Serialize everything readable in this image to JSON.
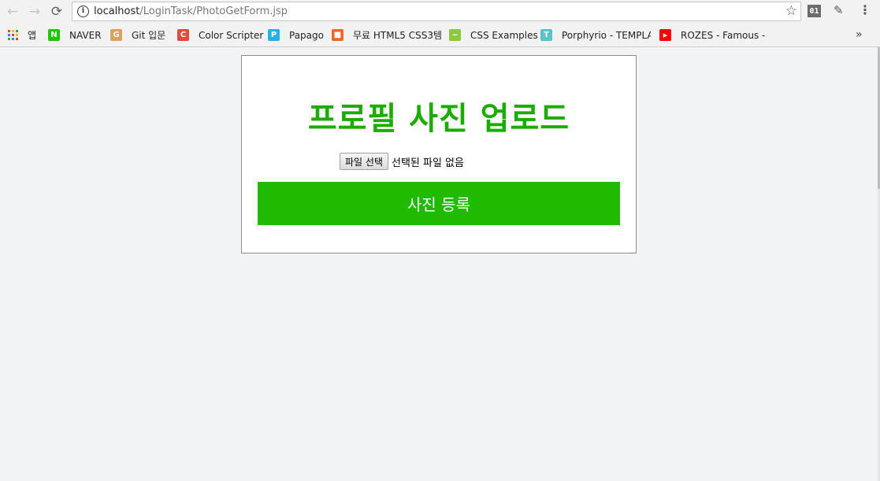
{
  "browser": {
    "url_host": "localhost",
    "url_path": "/LoginTask/PhotoGetForm.jsp",
    "extension_badge": "01"
  },
  "bookmarks": [
    {
      "label": "앱",
      "icon": "apps-grid-icon"
    },
    {
      "label": "NAVER",
      "icon": "naver-icon",
      "color": "#1ec800",
      "glyph": "N"
    },
    {
      "label": "Git 입문",
      "icon": "git-icon",
      "color": "#d9a25f",
      "glyph": "G"
    },
    {
      "label": "Color Scripter",
      "icon": "color-scripter-icon",
      "color": "#e8473d",
      "glyph": "C"
    },
    {
      "label": "Papago",
      "icon": "papago-icon",
      "color": "#21b2e6",
      "glyph": "P"
    },
    {
      "label": "무료 HTML5 CSS3템",
      "icon": "template-icon",
      "color": "#f26522",
      "glyph": "■"
    },
    {
      "label": "CSS Examples",
      "icon": "css-examples-icon",
      "color": "#8dc63f",
      "glyph": "~"
    },
    {
      "label": "Porphyrio - TEMPLA",
      "icon": "porphyrio-icon",
      "color": "#5bc0c8",
      "glyph": "T"
    },
    {
      "label": "ROZES - Famous - Y",
      "icon": "youtube-icon",
      "color": "#ff0000",
      "glyph": "▶"
    }
  ],
  "form": {
    "title": "프로필 사진 업로드",
    "file_button_label": "파일 선택",
    "file_status": "선택된 파일 없음",
    "submit_label": "사진 등록"
  },
  "colors": {
    "title": "#1cac00",
    "submit_bg": "#20bb00",
    "page_bg": "#f2f3f5"
  }
}
